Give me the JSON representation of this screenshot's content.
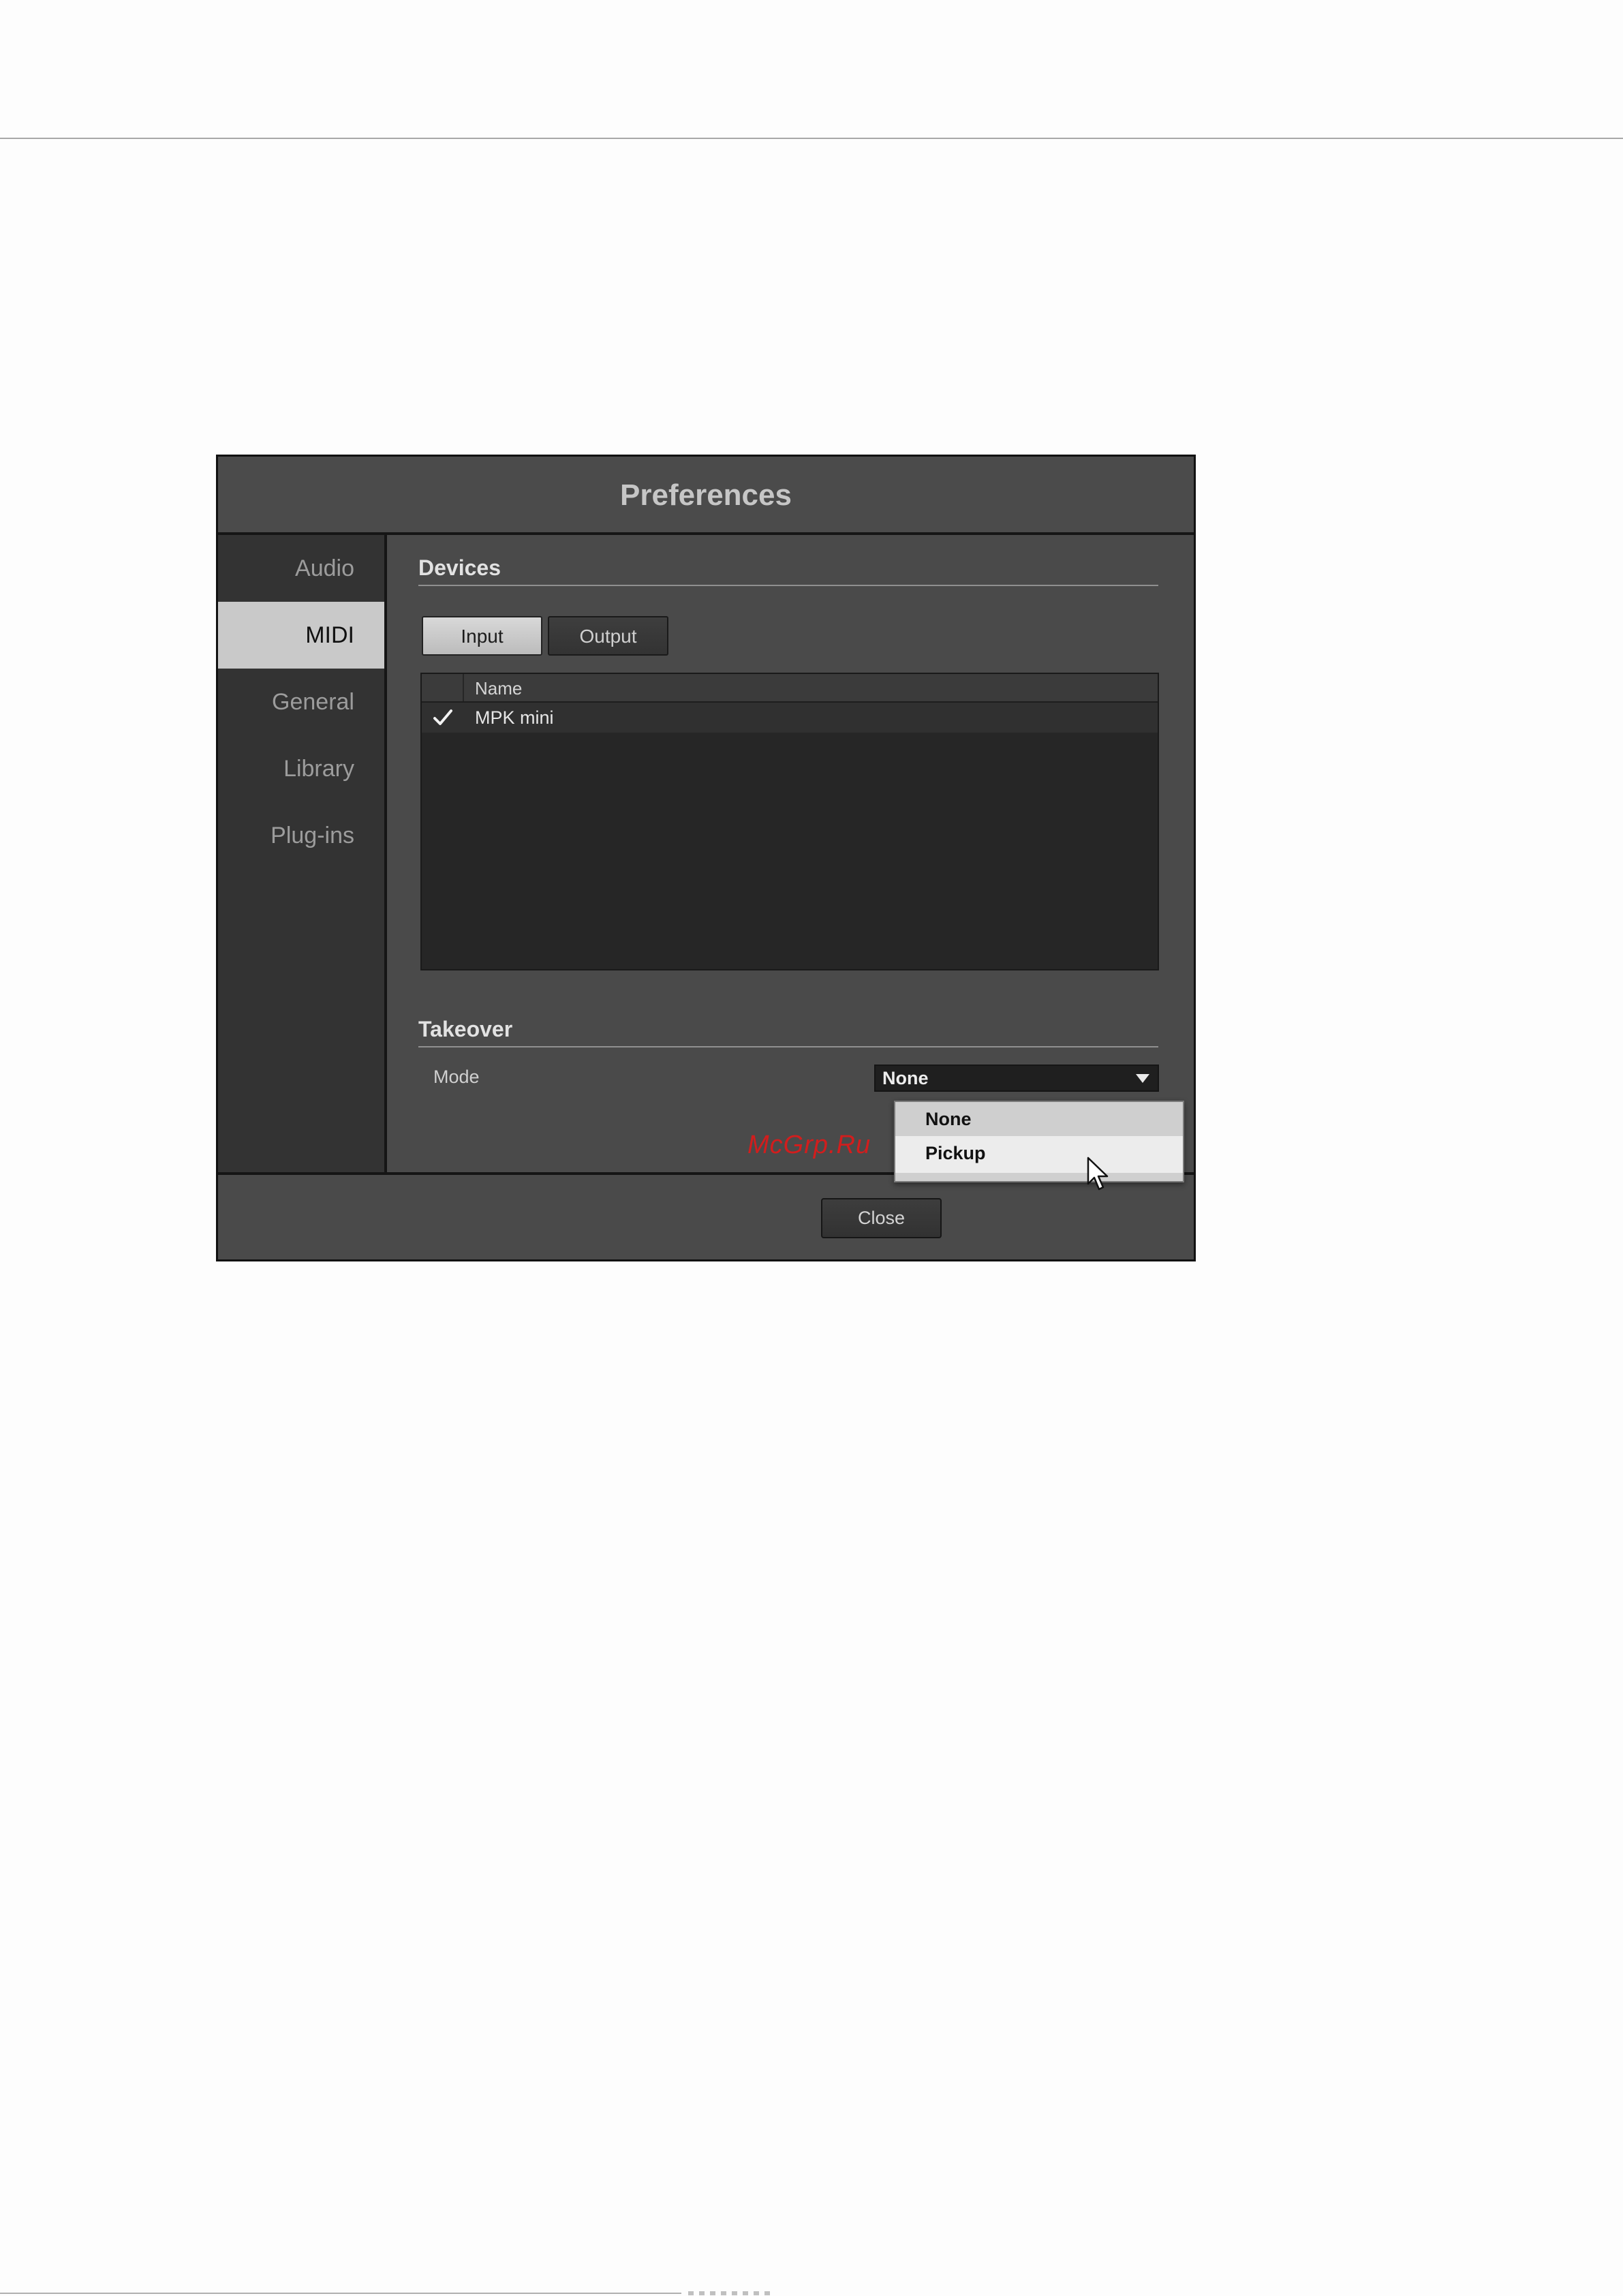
{
  "dialog": {
    "title": "Preferences"
  },
  "sidebar": {
    "items": [
      {
        "label": "Audio"
      },
      {
        "label": "MIDI"
      },
      {
        "label": "General"
      },
      {
        "label": "Library"
      },
      {
        "label": "Plug-ins"
      }
    ],
    "active": "MIDI"
  },
  "devices": {
    "title": "Devices",
    "input_label": "Input",
    "output_label": "Output",
    "selected_tab": "Input",
    "table": {
      "columns": [
        "",
        "Name"
      ],
      "rows": [
        {
          "checked": true,
          "name": "MPK mini"
        }
      ]
    }
  },
  "takeover": {
    "title": "Takeover",
    "mode_label": "Mode",
    "mode_value": "None",
    "options": [
      "None",
      "Pickup"
    ],
    "hovered_option": "Pickup"
  },
  "footer": {
    "close_label": "Close"
  },
  "watermark": "McGrp.Ru",
  "colors": {
    "dialog_bg": "#4a4a4a",
    "sidebar_bg": "#333333",
    "active_nav_bg": "#c9c9c9",
    "watermark": "#d21d1d"
  }
}
